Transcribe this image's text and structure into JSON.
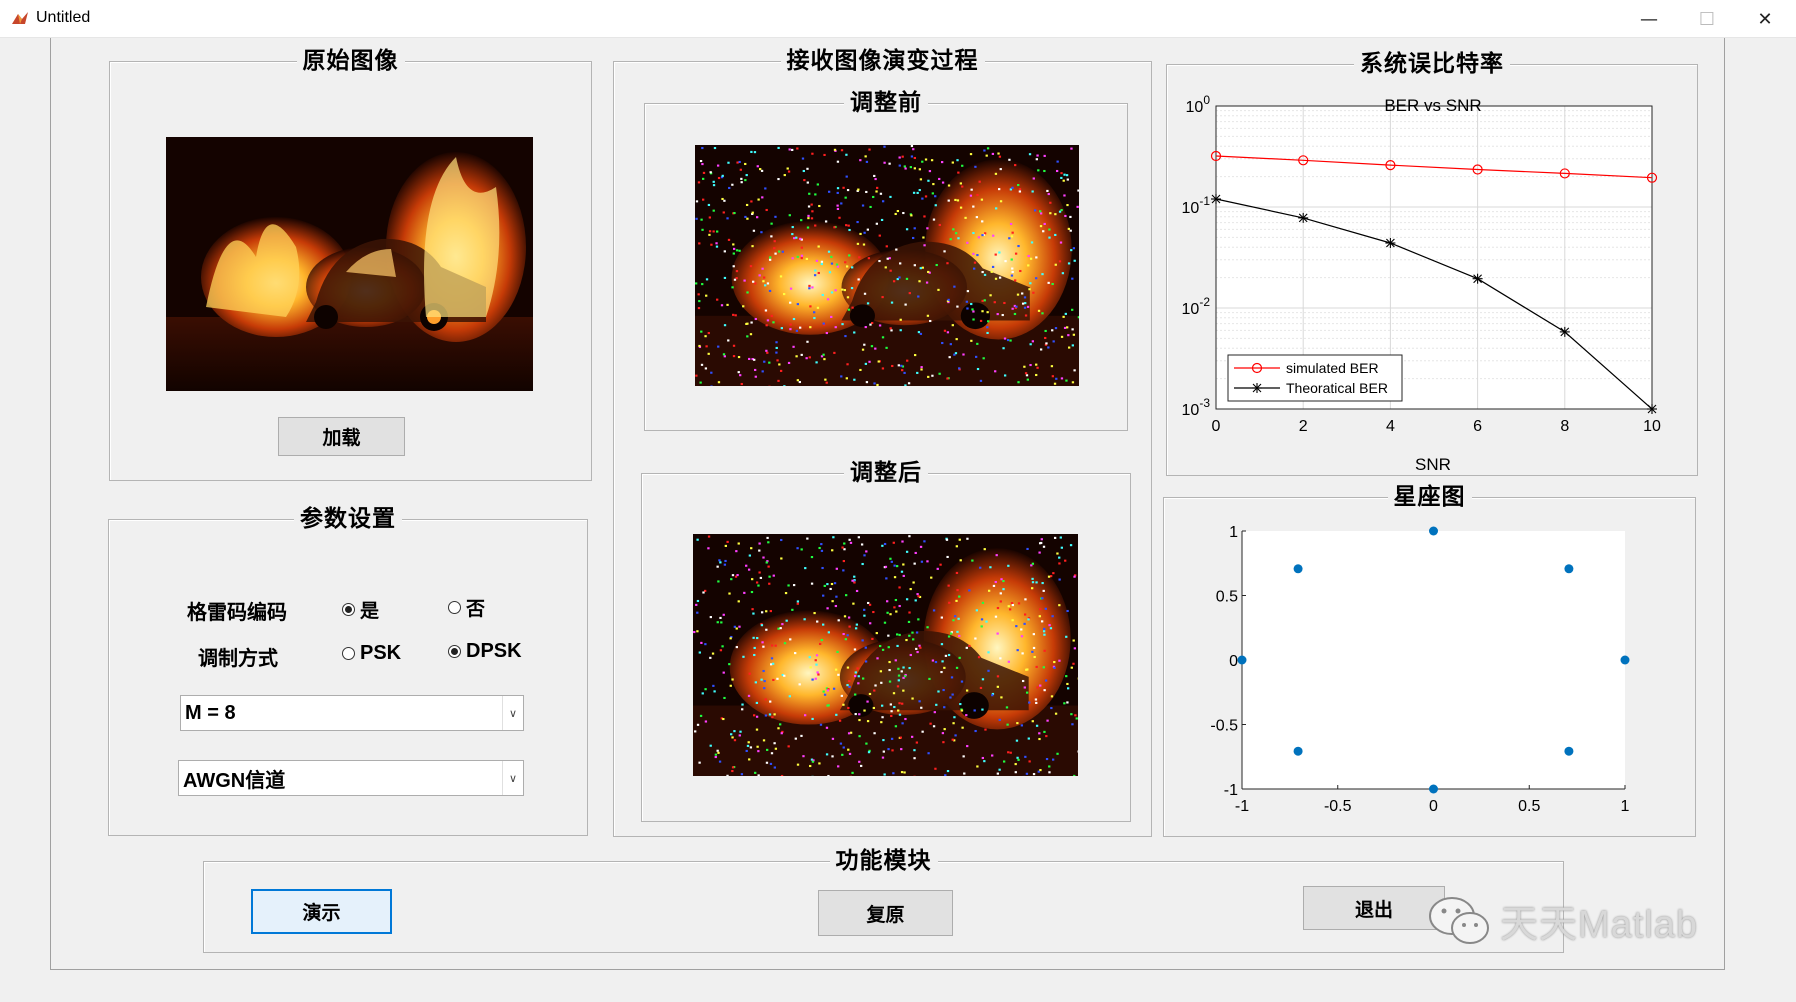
{
  "window": {
    "title": "Untitled",
    "minimize_glyph": "—",
    "maximize_glyph": "☐",
    "close_glyph": "✕"
  },
  "panels": {
    "original": {
      "title": "原始图像",
      "load_button": "加载"
    },
    "evolution": {
      "title": "接收图像演变过程",
      "before_title": "调整前",
      "after_title": "调整后"
    },
    "ber": {
      "title": "系统误比特率"
    },
    "constellation": {
      "title": "星座图"
    },
    "params": {
      "title": "参数设置",
      "trellis_label": "格雷码编码",
      "trellis_yes": "是",
      "trellis_no": "否",
      "trellis_selected": "是",
      "mod_label": "调制方式",
      "mod_psk": "PSK",
      "mod_dpsk": "DPSK",
      "mod_selected": "DPSK",
      "m_select": "M = 8",
      "channel_select": "AWGN信道"
    },
    "functions": {
      "title": "功能模块",
      "demo_button": "演示",
      "reset_button": "复原",
      "exit_button": "退出"
    }
  },
  "watermark": "天天Matlab",
  "colors": {
    "simulated": "#ff0000",
    "theoretical": "#000000",
    "constellation_point": "#0072bd",
    "focus_border": "#0078d7"
  },
  "chart_data": [
    {
      "type": "line",
      "title": "BER vs SNR",
      "xlabel": "SNR",
      "ylabel": "",
      "yscale": "log",
      "xlim": [
        0,
        10
      ],
      "ylim": [
        0.001,
        1
      ],
      "x_ticks": [
        "0",
        "2",
        "4",
        "6",
        "8",
        "10"
      ],
      "grid": true,
      "legend_position": "bottom-left",
      "x": [
        0,
        2,
        4,
        6,
        8,
        10
      ],
      "series": [
        {
          "name": "simulated BER",
          "color": "#ff0000",
          "marker": "o",
          "values": [
            0.32,
            0.29,
            0.26,
            0.235,
            0.215,
            0.195
          ]
        },
        {
          "name": "Theoratical BER",
          "color": "#000000",
          "marker": "*",
          "values": [
            0.12,
            0.078,
            0.044,
            0.0195,
            0.0058,
            0.001
          ]
        }
      ]
    },
    {
      "type": "scatter",
      "title": "",
      "xlim": [
        -1,
        1
      ],
      "ylim": [
        -1,
        1
      ],
      "x_ticks": [
        "-1",
        "-0.5",
        "0",
        "0.5",
        "1"
      ],
      "y_ticks": [
        "1",
        "0.5",
        "0",
        "-0.5",
        "-1"
      ],
      "points": [
        [
          1,
          0
        ],
        [
          0.7071,
          0.7071
        ],
        [
          0,
          1
        ],
        [
          -0.7071,
          0.7071
        ],
        [
          -1,
          0
        ],
        [
          -0.7071,
          -0.7071
        ],
        [
          0,
          -1
        ],
        [
          0.7071,
          -0.7071
        ]
      ]
    }
  ]
}
